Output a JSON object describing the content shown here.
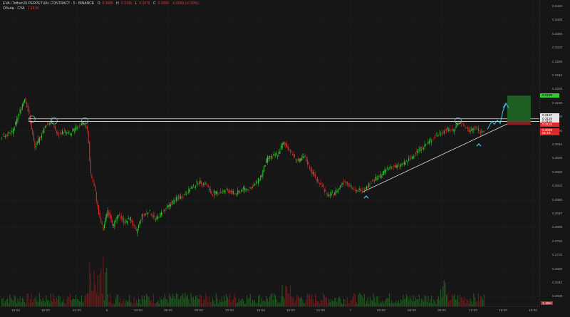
{
  "legend": {
    "symbol": "EVA / TetherUS PERPETUAL CONTRACT · 5 · BINANCE",
    "open_label": "O",
    "open": "0.3085",
    "high_label": "H",
    "high": "0.3106",
    "low_label": "L",
    "low": "0.3075",
    "close_label": "C",
    "close": "0.3090",
    "change": "-0.0009 (-0.30%)",
    "indicator_name": "Объём · CVA",
    "indicator_value": "1.18 M"
  },
  "colors": {
    "background": "#161616",
    "bull": "#2ecc2e",
    "bear": "#d92b2b",
    "target_zone": "#1e5e22",
    "stop_zone": "#8b1c22",
    "projection": "#3fc5e6",
    "level_line": "#e8e8e8"
  },
  "price_axis": {
    "ticks": [
      "0.3440",
      "0.3400",
      "0.3360",
      "0.3320",
      "0.3280",
      "0.3240",
      "0.3200",
      "0.3160",
      "0.3120",
      "0.3080",
      "0.3040",
      "0.3000",
      "0.2960",
      "0.2920",
      "0.2880",
      "0.2840",
      "0.2800",
      "0.2760",
      "0.2720",
      "0.2680",
      "0.2640",
      "0.2600"
    ],
    "tags": [
      {
        "label": "0.3199",
        "value": 0.3194,
        "bg": "#2ecc2e",
        "fg": "#0a0a0a"
      },
      {
        "label": "0.3137",
        "value": 0.3137,
        "bg": "#e6e6e6",
        "fg": "#111111"
      },
      {
        "label": "0.3126",
        "value": 0.3126,
        "bg": "#e6e6e6",
        "fg": "#111111"
      },
      {
        "label": "0.3118",
        "value": 0.3117,
        "bg": "#e6e6e6",
        "fg": "#111111"
      },
      {
        "label": "0.3113",
        "value": 0.3108,
        "bg": "#d92b2b",
        "fg": "#ffffff"
      },
      {
        "label": "0.3089",
        "value": 0.3091,
        "bg": "#d92b2b",
        "fg": "#ffffff"
      },
      {
        "label": "01:18",
        "value": 0.3083,
        "bg": "#d92b2b",
        "fg": "#ffffff"
      }
    ]
  },
  "time_axis": {
    "ticks": [
      "15:00",
      "18:00",
      "21:00",
      "6",
      "03:00",
      "06:00",
      "09:00",
      "12:00",
      "15:00",
      "18:00",
      "21:00",
      "7",
      "03:00",
      "06:00",
      "09:00",
      "12:00",
      "15:00",
      "18:00"
    ]
  },
  "volume_badge": "1.18M",
  "chart_data": {
    "type": "candlestick",
    "timeframe": "5",
    "ylim": [
      0.26,
      0.345
    ],
    "x": [
      "15:00",
      "18:00",
      "21:00",
      "6",
      "03:00",
      "06:00",
      "09:00",
      "12:00",
      "15:00",
      "18:00",
      "21:00",
      "7",
      "03:00",
      "06:00",
      "09:00",
      "12:00"
    ],
    "close": [
      0.3085,
      0.312,
      0.3113,
      0.288,
      0.2855,
      0.292,
      0.294,
      0.299,
      0.299,
      0.307,
      0.301,
      0.297,
      0.301,
      0.305,
      0.3105,
      0.31
    ],
    "horizontal_levels": [
      0.3126,
      0.3118
    ],
    "trendline": {
      "from": [
        "7",
        0.2975
      ],
      "to": [
        "12:00",
        0.3115
      ]
    },
    "target_zone": [
      0.3118,
      0.3194
    ],
    "stop_zone": [
      0.3108,
      0.3118
    ]
  }
}
